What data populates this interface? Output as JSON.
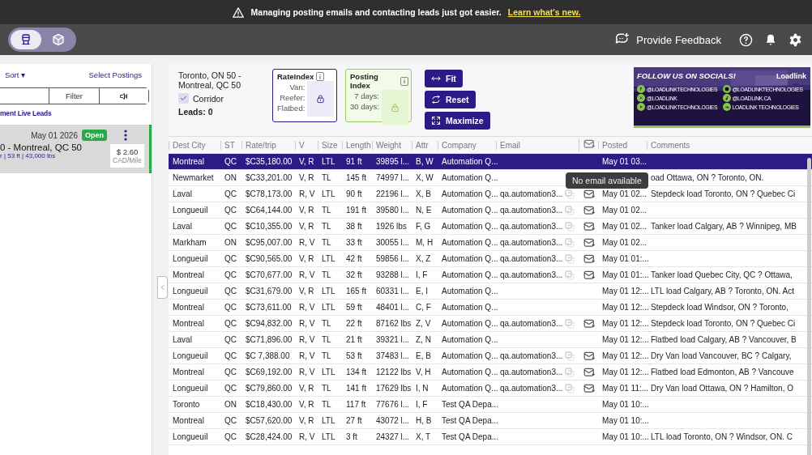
{
  "announcement": {
    "text": "Managing posting emails and contacting leads just got easier.",
    "link": "Learn what's new."
  },
  "header": {
    "modes": [
      {
        "kind": "truck",
        "selected": true
      },
      {
        "kind": "box",
        "selected": false
      }
    ],
    "feedback": "Provide Feedback"
  },
  "sidebar": {
    "sort": "Sort ▾",
    "select": "Select Postings",
    "segments": [
      {
        "kind": "blank"
      },
      {
        "kind": "text",
        "label": "Filter"
      },
      {
        "kind": "sound"
      }
    ],
    "section": "ment Live Leads",
    "card": {
      "date": "May 01  2026",
      "status": "Open",
      "route": "0  -  Montreal, QC 50",
      "details": "r | 53 ft | 43,000 lbs",
      "rate": "$ 2.60",
      "unit": "CAD/Mile"
    }
  },
  "summary": {
    "route": "Toronto, ON 50 - Montreal, QC 50",
    "corridor": {
      "label": "Corridor",
      "checked": true
    },
    "leads": "Leads: 0",
    "rate_index": {
      "title": "RateIndex",
      "labels": [
        "Van:",
        "Reefer:",
        "Flatbed:"
      ]
    },
    "posting_index": {
      "title": "Posting Index",
      "labels": [
        "7 days:",
        "30 days:"
      ]
    },
    "buttons": [
      {
        "kind": "fit",
        "label": "Fit"
      },
      {
        "kind": "reset",
        "label": "Reset"
      },
      {
        "kind": "maximize",
        "label": "Maximize"
      }
    ]
  },
  "promo": {
    "title": "FOLLOW US ON SOCIALS!",
    "brand": "Loadlink",
    "handles": [
      {
        "kind": "facebook",
        "text": "@LOADLINKTECHNOLOGIES"
      },
      {
        "kind": "instagram",
        "text": "@LOADLINKTECHNOLOGIES"
      },
      {
        "kind": "x",
        "text": "@LOADLINK"
      },
      {
        "kind": "tiktok",
        "text": "@LOADLINK.CA"
      },
      {
        "kind": "youtube",
        "text": "@LOADLINKTECHNOLOGIES"
      },
      {
        "kind": "linkedin",
        "text": "LOADLINK TECHNOLOGIES"
      }
    ]
  },
  "table": {
    "columns": [
      "Dest City",
      "ST",
      "Rate/trip",
      "V",
      "Size",
      "Length",
      "Weight",
      "Attr",
      "Company",
      "Email",
      "",
      "",
      "Posted",
      "Comments"
    ],
    "tooltip": "No email available",
    "rows": [
      {
        "city": "Montreal",
        "st": "QC",
        "rate": "$C35,180.00",
        "v": "V, R",
        "size": "LTL",
        "length": "91 ft",
        "weight": "39895 l...",
        "attr": "B, W",
        "company": "Automation Q...",
        "posted": "May 01 03...",
        "selected": true
      },
      {
        "city": "Newmarket",
        "st": "ON",
        "rate": "$C33,201.00",
        "v": "V, R",
        "size": "TL",
        "length": "145 ft",
        "weight": "74997 l...",
        "attr": "X, W",
        "company": "Automation Q...",
        "comment": "oad Ottawa, ON ? Toronto, ON.",
        "selected": false
      },
      {
        "city": "Laval",
        "st": "QC",
        "rate": "$C78,173.00",
        "v": "R, V",
        "size": "LTL",
        "length": "90 ft",
        "weight": "22196 l...",
        "attr": "X, B",
        "company": "Automation Q...",
        "email": "qa.automation3...",
        "posted": "May 01 02...",
        "comment": "Stepdeck load Toronto, ON ? Quebec Ci",
        "selected": false
      },
      {
        "city": "Longueuil",
        "st": "QC",
        "rate": "$C64,144.00",
        "v": "V, R",
        "size": "TL",
        "length": "191 ft",
        "weight": "39580 l...",
        "attr": "N, E",
        "company": "Automation Q...",
        "email": "qa.automation3...",
        "posted": "May 01 02...",
        "selected": false
      },
      {
        "city": "Laval",
        "st": "QC",
        "rate": "$C10,355.00",
        "v": "V, R",
        "size": "TL",
        "length": "38 ft",
        "weight": "1926 lbs",
        "attr": "F, G",
        "company": "Automation Q...",
        "email": "qa.automation3...",
        "posted": "May 01 02...",
        "comment": "Tanker load Calgary, AB ? Winnipeg, MB",
        "selected": false
      },
      {
        "city": "Markham",
        "st": "ON",
        "rate": "$C95,007.00",
        "v": "R, V",
        "size": "TL",
        "length": "33 ft",
        "weight": "30055 l...",
        "attr": "M, H",
        "company": "Automation Q...",
        "email": "qa.automation3...",
        "posted": "May 01 02...",
        "selected": false
      },
      {
        "city": "Longueuil",
        "st": "QC",
        "rate": "$C90,565.00",
        "v": "V, R",
        "size": "LTL",
        "length": "42 ft",
        "weight": "59856 l...",
        "attr": "X, Z",
        "company": "Automation Q...",
        "email": "qa.automation3...",
        "posted": "May 01 01:...",
        "selected": false
      },
      {
        "city": "Montreal",
        "st": "QC",
        "rate": "$C70,677.00",
        "v": "R, V",
        "size": "TL",
        "length": "32 ft",
        "weight": "93288 l...",
        "attr": "I, F",
        "company": "Automation Q...",
        "email": "qa.automation3...",
        "posted": "May 01 01:...",
        "comment": "Tanker load Quebec City, QC ? Ottawa,",
        "selected": false
      },
      {
        "city": "Longueuil",
        "st": "QC",
        "rate": "$C31,679.00",
        "v": "V, R",
        "size": "LTL",
        "length": "165 ft",
        "weight": "60331 l...",
        "attr": "E, I",
        "company": "Automation Q...",
        "posted": "May 01 12:...",
        "comment": "LTL load Calgary, AB ? Toronto, ON. Act",
        "selected": false
      },
      {
        "city": "Montreal",
        "st": "QC",
        "rate": "$C73,611.00",
        "v": "R, V",
        "size": "LTL",
        "length": "59 ft",
        "weight": "48401 l...",
        "attr": "C, F",
        "company": "Automation Q...",
        "posted": "May 01 12:...",
        "comment": "Stepdeck load Windsor, ON ? Toronto,",
        "selected": false
      },
      {
        "city": "Montreal",
        "st": "QC",
        "rate": "$C94,832.00",
        "v": "R, V",
        "size": "TL",
        "length": "22 ft",
        "weight": "87162 lbs",
        "attr": "Z, V",
        "company": "Automation Q...",
        "email": "qa.automation3...",
        "posted": "May 01 12:...",
        "comment": "Stepdeck load Toronto, ON ? Quebec Ci",
        "selected": false
      },
      {
        "city": "Laval",
        "st": "QC",
        "rate": "$C71,896.00",
        "v": "R, V",
        "size": "TL",
        "length": "21 ft",
        "weight": "39321 l...",
        "attr": "Z, N",
        "company": "Automation Q...",
        "posted": "May 01 12:...",
        "comment": "Flatbed load Calgary, AB ? Vancouver, B",
        "selected": false
      },
      {
        "city": "Longueuil",
        "st": "QC",
        "rate": "$C 7,388.00",
        "v": "R, V",
        "size": "TL",
        "length": "53 ft",
        "weight": "37483 l...",
        "attr": "E, B",
        "company": "Automation Q...",
        "email": "qa.automation3...",
        "posted": "May 01 12:...",
        "comment": "Dry Van load Vancouver, BC ? Calgary,",
        "selected": false
      },
      {
        "city": "Montreal",
        "st": "QC",
        "rate": "$C69,192.00",
        "v": "R, V",
        "size": "LTL",
        "length": "134 ft",
        "weight": "12122 lbs",
        "attr": "V, H",
        "company": "Automation Q...",
        "email": "qa.automation3...",
        "posted": "May 01 12:...",
        "comment": "Flatbed load Edmonton, AB ? Vancouve",
        "selected": false
      },
      {
        "city": "Longueuil",
        "st": "QC",
        "rate": "$C79,860.00",
        "v": "V, R",
        "size": "TL",
        "length": "141 ft",
        "weight": "17629 lbs",
        "attr": "I, N",
        "company": "Automation Q...",
        "email": "qa.automation3...",
        "posted": "May 01 11:...",
        "comment": "Dry Van load Ottawa, ON ? Hamilton, O",
        "selected": false
      },
      {
        "city": "Toronto",
        "st": "ON",
        "rate": "$C18,430.00",
        "v": "V, R",
        "size": "TL",
        "length": "117 ft",
        "weight": "77676 l...",
        "attr": "I, F",
        "company": "Test QA Depa...",
        "posted": "May 01 10:...",
        "selected": false
      },
      {
        "city": "Montreal",
        "st": "QC",
        "rate": "$C57,620.00",
        "v": "V, R",
        "size": "LTL",
        "length": "27 ft",
        "weight": "43072 l...",
        "attr": "H, B",
        "company": "Test QA Depa...",
        "posted": "May 01 10:...",
        "selected": false
      },
      {
        "city": "Longueuil",
        "st": "QC",
        "rate": "$C28,424.00",
        "v": "R, V",
        "size": "LTL",
        "length": "3 ft",
        "weight": "24327 l...",
        "attr": "X, T",
        "company": "Test QA Depa...",
        "posted": "May 01 10:...",
        "comment": "LTL load Toronto, ON ? Windsor, ON. C",
        "selected": false
      }
    ]
  }
}
